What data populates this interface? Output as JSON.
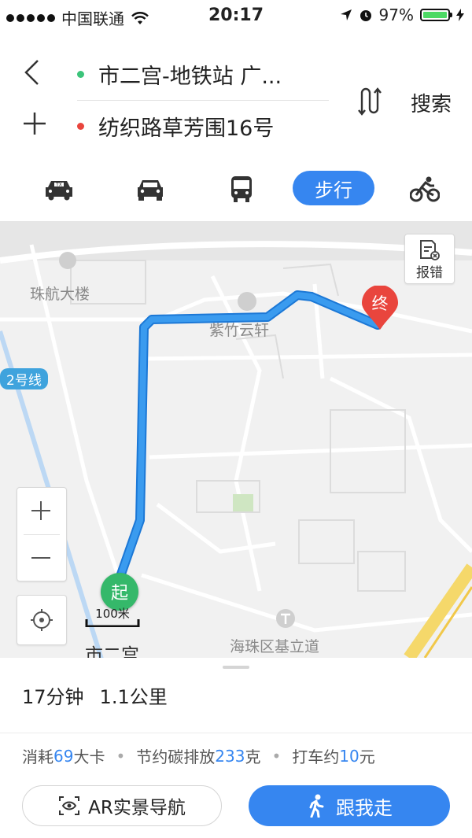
{
  "status_bar": {
    "carrier": "中国联通",
    "time": "20:17",
    "battery": "97%"
  },
  "route": {
    "origin": "市二宫-地铁站 广...",
    "destination": "纺织路草芳围16号",
    "search_label": "搜索",
    "origin_color": "#3cc47a",
    "destination_color": "#e9453d"
  },
  "modes": {
    "active_label": "步行",
    "items": [
      "taxi-icon",
      "car-icon",
      "bus-icon",
      "步行",
      "bike-icon"
    ]
  },
  "map": {
    "labels": {
      "zhuhang": "珠航大楼",
      "zizhu": "紫竹云轩",
      "line2": "2号线",
      "haizhu": "海珠区基立道",
      "shiergong": "市二宫"
    },
    "start_marker": "起",
    "end_marker": "终",
    "report_label": "报错",
    "scale": "100米",
    "route_color": "#3a9bef"
  },
  "summary": {
    "duration": "17分钟",
    "distance": "1.1公里"
  },
  "stats": {
    "calorie_prefix": "消耗",
    "calorie_value": "69",
    "calorie_suffix": "大卡",
    "carbon_prefix": "节约碳排放",
    "carbon_value": "233",
    "carbon_suffix": "克",
    "taxi_prefix": "打车约",
    "taxi_value": "10",
    "taxi_suffix": "元"
  },
  "actions": {
    "ar_label": "AR实景导航",
    "follow_label": "跟我走"
  }
}
